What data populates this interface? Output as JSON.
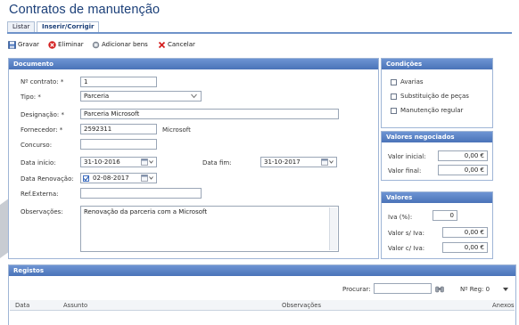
{
  "page": {
    "title": "Contratos de manutenção"
  },
  "tabs": [
    {
      "label": "Listar"
    },
    {
      "label": "Inserir/Corrigir"
    }
  ],
  "toolbar": {
    "save": "Gravar",
    "delete": "Eliminar",
    "add_assets": "Adicionar bens",
    "cancel": "Cancelar"
  },
  "documento": {
    "title": "Documento",
    "contract_no": {
      "label": "Nº contrato: *",
      "value": "1"
    },
    "type": {
      "label": "Tipo: *",
      "value": "Parceria"
    },
    "designation": {
      "label": "Designação: *",
      "value": "Parceria Microsoft"
    },
    "supplier": {
      "label": "Fornecedor: *",
      "value": "2592311",
      "name": "Microsoft"
    },
    "tender": {
      "label": "Concurso:",
      "value": ""
    },
    "start_date": {
      "label": "Data início:",
      "value": "31-10-2016"
    },
    "end_date": {
      "label": "Data fim:",
      "value": "31-10-2017"
    },
    "renewal_date": {
      "label": "Data Renovação:",
      "value": "02-08-2017",
      "checked": true
    },
    "external_ref": {
      "label": "Ref.Externa:",
      "value": ""
    },
    "notes": {
      "label": "Observações:",
      "value": "Renovação da parceria com a Microsoft"
    }
  },
  "condicoes": {
    "title": "Condições",
    "items": [
      {
        "label": "Avarias"
      },
      {
        "label": "Substituição de peças"
      },
      {
        "label": "Manutenção regular"
      }
    ]
  },
  "valores_negociados": {
    "title": "Valores negociados",
    "initial": {
      "label": "Valor inicial:",
      "value": "0,00 €"
    },
    "final": {
      "label": "Valor final:",
      "value": "0,00 €"
    }
  },
  "valores": {
    "title": "Valores",
    "iva": {
      "label": "Iva (%):",
      "value": "0"
    },
    "no_iva": {
      "label": "Valor s/ Iva:",
      "value": "0,00 €"
    },
    "with_iva": {
      "label": "Valor c/ Iva:",
      "value": "0,00 €"
    }
  },
  "registos": {
    "title": "Registos",
    "search_label": "Procurar:",
    "count_label": "Nº Reg: 0",
    "columns": [
      "Data",
      "Assunto",
      "Observações",
      "Anexos"
    ]
  },
  "colors": {
    "header_blue": "#4a73b8",
    "title_blue": "#1b3f78",
    "delete_red": "#d42020"
  }
}
